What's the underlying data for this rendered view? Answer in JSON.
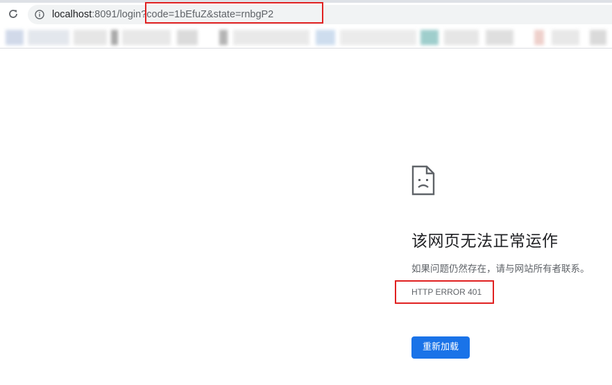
{
  "browser": {
    "address_bar": {
      "host": "localhost",
      "port_path": ":8091/login",
      "query": "?code=1bEfuZ&state=rnbgP2"
    },
    "highlight_color": "#e02020"
  },
  "error_page": {
    "icon": "sad-document-icon",
    "title": "该网页无法正常运作",
    "description": "如果问题仍然存在，请与网站所有者联系。",
    "error_code": "HTTP ERROR 401",
    "reload_button_label": "重新加载",
    "button_color": "#1a73e8"
  }
}
